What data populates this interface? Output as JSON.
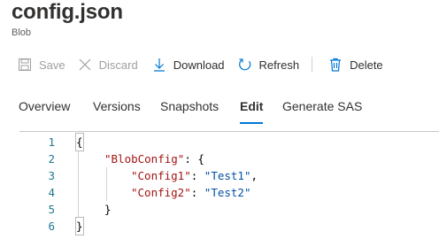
{
  "header": {
    "title": "config.json",
    "subtitle": "Blob"
  },
  "toolbar": {
    "save_label": "Save",
    "discard_label": "Discard",
    "download_label": "Download",
    "refresh_label": "Refresh",
    "delete_label": "Delete"
  },
  "tabs": [
    {
      "label": "Overview",
      "active": false
    },
    {
      "label": "Versions",
      "active": false
    },
    {
      "label": "Snapshots",
      "active": false
    },
    {
      "label": "Edit",
      "active": true
    },
    {
      "label": "Generate SAS",
      "active": false
    }
  ],
  "editor": {
    "lines": [
      {
        "n": "1",
        "text": "{"
      },
      {
        "n": "2",
        "key": "\"BlobConfig\"",
        "rest": ": {"
      },
      {
        "n": "3",
        "key": "\"Config1\"",
        "sep": ": ",
        "value": "\"Test1\"",
        "end": ","
      },
      {
        "n": "4",
        "key": "\"Config2\"",
        "sep": ": ",
        "value": "\"Test2\"",
        "end": ""
      },
      {
        "n": "5",
        "text": "}"
      },
      {
        "n": "6",
        "text": "}"
      }
    ]
  },
  "colors": {
    "accent": "#0078d4",
    "json_key": "#a31515",
    "json_string": "#0451a5",
    "line_number": "#237893"
  },
  "icons": [
    "save-icon",
    "close-icon",
    "download-icon",
    "refresh-icon",
    "trash-icon"
  ]
}
